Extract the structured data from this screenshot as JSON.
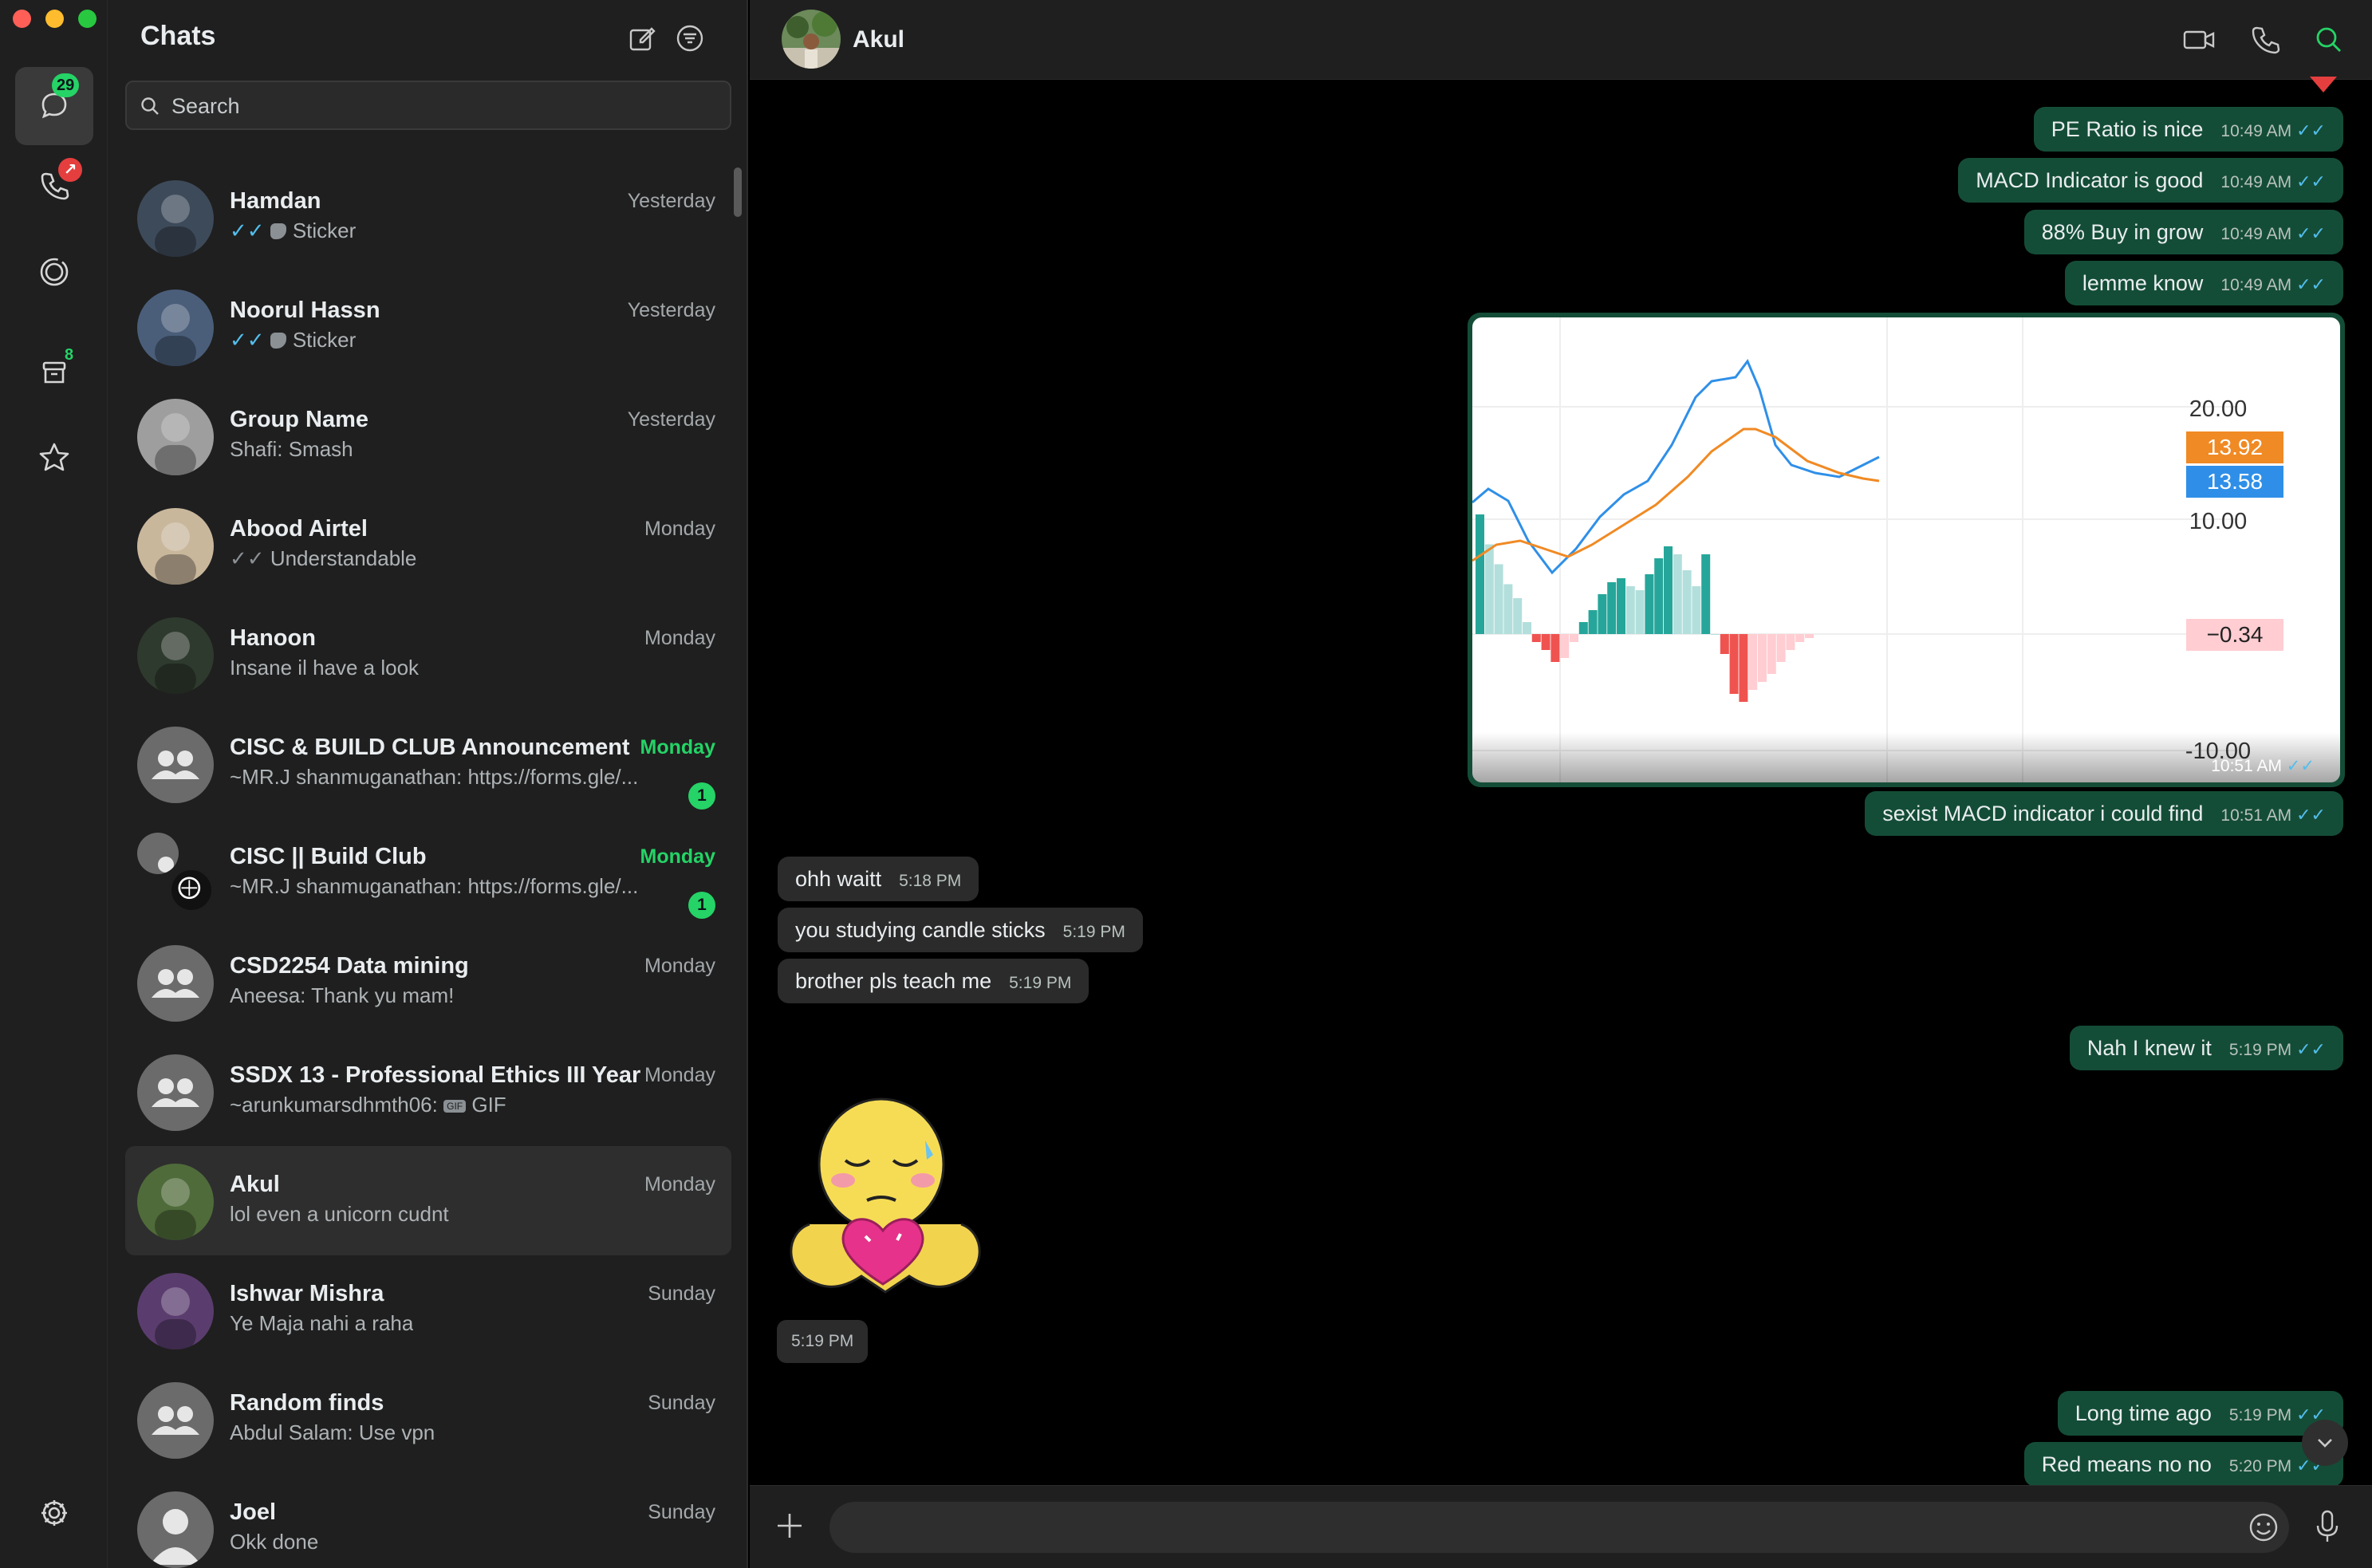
{
  "window": {
    "traffic_colors": [
      "#ff5f57",
      "#febc2e",
      "#28c840"
    ]
  },
  "rail": {
    "chats_badge": "29",
    "archived_badge": "8"
  },
  "list": {
    "title": "Chats",
    "search_placeholder": "Search",
    "chats": [
      {
        "name": "Hamdan",
        "time": "Yesterday",
        "tick": "✓✓",
        "tick_style": "blue",
        "preview": "Sticker",
        "preview_icon": "sticker",
        "avatar_color": "#3d4a5a"
      },
      {
        "name": "Noorul Hassn",
        "time": "Yesterday",
        "tick": "✓✓",
        "tick_style": "blue",
        "preview": "Sticker",
        "preview_icon": "sticker",
        "avatar_color": "#4a5e7a"
      },
      {
        "name": "Group Name",
        "time": "Yesterday",
        "tick": "",
        "tick_style": "",
        "preview": "Shafi: Smash",
        "preview_icon": "",
        "avatar_color": "#9e9e9e"
      },
      {
        "name": "Abood Airtel",
        "time": "Monday",
        "tick": "✓✓",
        "tick_style": "grey",
        "preview": "Understandable",
        "preview_icon": "",
        "avatar_color": "#c9b79c"
      },
      {
        "name": "Hanoon",
        "time": "Monday",
        "tick": "",
        "tick_style": "",
        "preview": "Insane il have a look",
        "preview_icon": "",
        "avatar_color": "#2f3a2e"
      },
      {
        "name": "CISC & BUILD CLUB Announcement",
        "time": "Monday",
        "time_green": true,
        "tick": "",
        "preview": "~MR.J shanmuganathan: https://forms.gle/...",
        "unread": "1",
        "group": true
      },
      {
        "name": "CISC || Build  Club",
        "time": "Monday",
        "time_green": true,
        "tick": "",
        "preview": "~MR.J shanmuganathan: https://forms.gle/...",
        "unread": "1",
        "group": true,
        "subgroup": true
      },
      {
        "name": "CSD2254 Data mining",
        "time": "Monday",
        "tick": "",
        "preview": "Aneesa: Thank yu mam!",
        "group": true
      },
      {
        "name": "SSDX 13 - Professional Ethics III Year",
        "time": "Monday",
        "tick": "",
        "preview": "~arunkumarsdhmth06:",
        "preview_gif": "GIF",
        "group": true
      },
      {
        "name": "Akul",
        "time": "Monday",
        "tick": "",
        "preview": "lol even a unicorn cudnt",
        "active": true,
        "avatar_color": "#4f6b3a"
      },
      {
        "name": "Ishwar Mishra",
        "time": "Sunday",
        "tick": "",
        "preview": "Ye Maja nahi a raha",
        "avatar_color": "#5a3d6e"
      },
      {
        "name": "Random finds",
        "time": "Sunday",
        "tick": "",
        "preview": "Abdul Salam: Use vpn",
        "group": true
      },
      {
        "name": "Joel",
        "time": "Sunday",
        "tick": "",
        "preview": "Okk done",
        "person": true
      }
    ]
  },
  "conversation": {
    "contact_name": "Akul",
    "messages": [
      {
        "dir": "out",
        "text": "PE Ratio is nice",
        "time": "10:49 AM"
      },
      {
        "dir": "out",
        "text": "MACD Indicator is good",
        "time": "10:49 AM"
      },
      {
        "dir": "out",
        "text": "88% Buy in grow",
        "time": "10:49 AM"
      },
      {
        "dir": "out",
        "text": "lemme know",
        "time": "10:49 AM"
      },
      {
        "dir": "out",
        "text": "sexist MACD indicator i could find",
        "time": "10:51 AM"
      },
      {
        "dir": "in",
        "text": "ohh waitt",
        "time": "5:18 PM"
      },
      {
        "dir": "in",
        "text": "you studying candle sticks",
        "time": "5:19 PM"
      },
      {
        "dir": "in",
        "text": "brother pls teach me",
        "time": "5:19 PM"
      },
      {
        "dir": "out",
        "text": "Nah I knew it",
        "time": "5:19 PM"
      },
      {
        "dir": "out",
        "text": "Long time ago",
        "time": "5:19 PM"
      },
      {
        "dir": "out",
        "text": "Red means no no",
        "time": "5:20 PM"
      }
    ],
    "image_time": "10:51 AM",
    "sticker_time": "5:19 PM",
    "tick": "✓✓"
  },
  "chart_image": {
    "y_ticks": [
      "20.00",
      "10.00",
      "-10.00"
    ],
    "label_orange": "13.92",
    "label_blue": "13.58",
    "label_hist": "−0.34",
    "colors": {
      "orange": "#f08a24",
      "blue": "#2f8fe8",
      "hist_pos": "#26a69a",
      "hist_pos_light": "#b2dfdb",
      "hist_neg": "#ef5350",
      "hist_neg_light": "#ffcdd2"
    }
  },
  "composer": {
    "placeholder": ""
  }
}
